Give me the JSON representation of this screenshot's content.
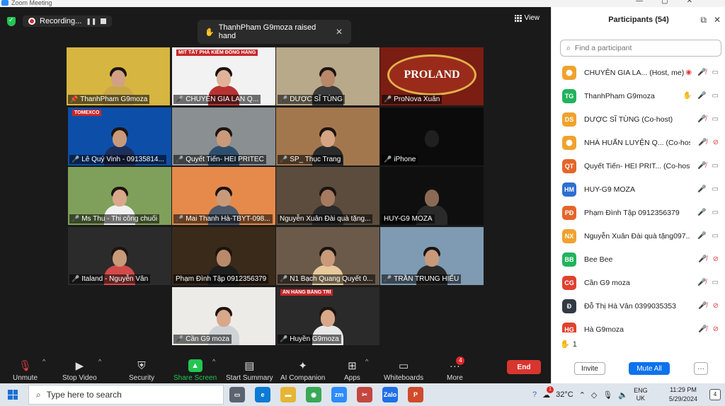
{
  "window": {
    "title": "Zoom Meeting"
  },
  "top": {
    "recording_label": "Recording...",
    "notification_text": "ThanhPham G9moza raised hand",
    "view_label": "View"
  },
  "tiles": [
    {
      "name": "ThanhPham G9moza",
      "muted": false,
      "hand": true,
      "bg": "#d6b640",
      "body": "#c9a84a",
      "hair": "#1c1410",
      "skin": "#d3a085",
      "banner": ""
    },
    {
      "name": "CHUYÊN GIA LAN Q...",
      "muted": true,
      "hand": false,
      "bg": "#f2f2f2",
      "body": "#b83232",
      "hair": "#1c1410",
      "skin": "#e0b399",
      "banner": "MIT TẮT PHÁ KIỂM ĐỒNG HÀNG"
    },
    {
      "name": "DƯỢC SĨ TÙNG",
      "muted": true,
      "hand": false,
      "bg": "#b9a98b",
      "body": "#3b3b3b",
      "hair": "#1c1410",
      "skin": "#b9876a",
      "banner": ""
    },
    {
      "name": "ProNova Xuân",
      "muted": true,
      "hand": false,
      "bg": "#7b1d12",
      "body": "#7b1d12",
      "hair": "#7b1d12",
      "skin": "#7b1d12",
      "banner": "",
      "logo": "PROLAND"
    },
    {
      "name": "Lê Quý Vinh - 09135814...",
      "muted": true,
      "hand": false,
      "bg": "#0d4fa8",
      "body": "#1d2f5c",
      "hair": "#1c1410",
      "skin": "#c99a7a",
      "banner": "TOMEXCO"
    },
    {
      "name": "Quyết Tiến- HEI PRITEC",
      "muted": true,
      "hand": false,
      "bg": "#8a8f92",
      "body": "#2e4e6e",
      "hair": "#1c1410",
      "skin": "#c99a7a",
      "banner": ""
    },
    {
      "name": "SP_ Thục Trang",
      "muted": true,
      "hand": false,
      "bg": "#a3774e",
      "body": "#2a2a2a",
      "hair": "#1c1410",
      "skin": "#d5a483",
      "banner": ""
    },
    {
      "name": "iPhone",
      "muted": true,
      "hand": false,
      "bg": "#0b0b0b",
      "body": "#0b0b0b",
      "hair": "#0b0b0b",
      "skin": "#202020",
      "banner": ""
    },
    {
      "name": "Ms Thu - Thi công chuối",
      "muted": true,
      "hand": false,
      "bg": "#7fa05a",
      "body": "#f1f1f1",
      "hair": "#1c1410",
      "skin": "#d9a88a",
      "banner": ""
    },
    {
      "name": "Mai Thanh Hà-TBYT-098...",
      "muted": true,
      "hand": false,
      "bg": "#e58a4b",
      "body": "#4d5a6b",
      "hair": "#1c1410",
      "skin": "#c99a7a",
      "banner": ""
    },
    {
      "name": "Nguyễn Xuân Đài quà tặng...",
      "muted": false,
      "hand": false,
      "bg": "#5b4c3d",
      "body": "#2a2a2a",
      "hair": "#1c1410",
      "skin": "#a57a5e",
      "banner": ""
    },
    {
      "name": "HUY-G9 MOZA",
      "muted": false,
      "hand": false,
      "bg": "#0f0f0f",
      "body": "#2a2a2a",
      "hair": "#111",
      "skin": "#8b6a55",
      "banner": ""
    },
    {
      "name": "Italand - Nguyễn Vân",
      "muted": true,
      "hand": false,
      "bg": "#2b2b2b",
      "body": "#d24a4a",
      "hair": "#1c1410",
      "skin": "#c99a7a",
      "banner": ""
    },
    {
      "name": "Phạm Đình Tập 0912356379",
      "muted": false,
      "hand": false,
      "bg": "#3a2a1a",
      "body": "#1e1e1e",
      "hair": "#1c1410",
      "skin": "#b98a6a",
      "banner": ""
    },
    {
      "name": "N1 Bạch Quang Quyết 0...",
      "muted": true,
      "hand": false,
      "bg": "#6b5a4a",
      "body": "#e7c99a",
      "hair": "#1c1410",
      "skin": "#c99a7a",
      "banner": ""
    },
    {
      "name": "TRẦN TRUNG HIẾU",
      "muted": true,
      "hand": false,
      "bg": "#7e9bb3",
      "body": "#2a2a2a",
      "hair": "#1c1410",
      "skin": "#c99a7a",
      "banner": ""
    },
    {
      "name": "Cần G9 moza",
      "muted": true,
      "hand": false,
      "bg": "#ecebe8",
      "body": "#cfd3d6",
      "hair": "#1c1410",
      "skin": "#d9a88a",
      "banner": ""
    },
    {
      "name": "Huyền G9moza",
      "muted": true,
      "hand": false,
      "bg": "#2a2a2a",
      "body": "#e8e8e8",
      "hair": "#1c1410",
      "skin": "#d9a88a",
      "banner": "ÁN HÀNG BẰNG TRÍ"
    }
  ],
  "toolbar": {
    "unmute": "Unmute",
    "stop_video": "Stop Video",
    "security": "Security",
    "share_screen": "Share Screen",
    "start_summary": "Start Summary",
    "ai_companion": "AI Companion",
    "apps": "Apps",
    "whiteboards": "Whiteboards",
    "more": "More",
    "more_badge": "4",
    "end": "End"
  },
  "panel": {
    "title": "Participants (54)",
    "search_placeholder": "Find a participant",
    "hand_count": "1",
    "invite": "Invite",
    "mute_all": "Mute All",
    "more": "···",
    "participants": [
      {
        "initials": "",
        "color": "#f0a22e",
        "name": "CHUYÊN GIA LA... (Host, me)",
        "hand": false,
        "rec": true,
        "mic": "off",
        "cam": "on",
        "logo": true
      },
      {
        "initials": "TG",
        "color": "#21b35c",
        "name": "ThanhPham G9moza",
        "hand": true,
        "rec": false,
        "mic": "on",
        "cam": "on",
        "logo": false
      },
      {
        "initials": "DS",
        "color": "#f0a22e",
        "name": "DƯỢC SĨ TÙNG (Co-host)",
        "hand": false,
        "rec": false,
        "mic": "off",
        "cam": "on",
        "logo": false
      },
      {
        "initials": "",
        "color": "#f0a22e",
        "name": "NHÀ HUẤN LUYỆN Q... (Co-host)",
        "hand": false,
        "rec": false,
        "mic": "off",
        "cam": "off",
        "logo": true
      },
      {
        "initials": "QT",
        "color": "#e5652a",
        "name": "Quyết Tiến- HEI PRIT... (Co-host)",
        "hand": false,
        "rec": false,
        "mic": "off",
        "cam": "on",
        "logo": false
      },
      {
        "initials": "HM",
        "color": "#2d6fd0",
        "name": "HUY-G9 MOZA",
        "hand": false,
        "rec": false,
        "mic": "on",
        "cam": "on",
        "logo": false
      },
      {
        "initials": "PĐ",
        "color": "#e5652a",
        "name": "Phạm Đình Tập 0912356379",
        "hand": false,
        "rec": false,
        "mic": "on",
        "cam": "on",
        "logo": false
      },
      {
        "initials": "NX",
        "color": "#f0a22e",
        "name": "Nguyễn Xuân Đài quà tặng097...",
        "hand": false,
        "rec": false,
        "mic": "on",
        "cam": "on",
        "logo": false
      },
      {
        "initials": "BB",
        "color": "#21b35c",
        "name": "Bee Bee",
        "hand": false,
        "rec": false,
        "mic": "off",
        "cam": "off",
        "logo": false
      },
      {
        "initials": "CG",
        "color": "#e0412f",
        "name": "Cần G9 moza",
        "hand": false,
        "rec": false,
        "mic": "off",
        "cam": "on",
        "logo": false
      },
      {
        "initials": "Đ",
        "color": "#333a45",
        "name": "Đỗ Thị Hà Vân 0399035353",
        "hand": false,
        "rec": false,
        "mic": "off",
        "cam": "off",
        "logo": false
      },
      {
        "initials": "HG",
        "color": "#e0412f",
        "name": "Hà G9moza",
        "hand": false,
        "rec": false,
        "mic": "off",
        "cam": "off",
        "logo": false
      }
    ]
  },
  "taskbar": {
    "search_placeholder": "Type here to search",
    "temperature": "32°C",
    "lang_top": "ENG",
    "lang_bottom": "UK",
    "time": "11:29 PM",
    "date": "5/29/2024",
    "weather_badge": "1",
    "notif_count": "4",
    "apps": [
      {
        "name": "task-view",
        "color": "#5a6470",
        "glyph": "▭"
      },
      {
        "name": "edge",
        "color": "#0b7bd3",
        "glyph": "e"
      },
      {
        "name": "file-explorer",
        "color": "#e7b535",
        "glyph": "▬"
      },
      {
        "name": "chrome",
        "color": "#3aa757",
        "glyph": "◉"
      },
      {
        "name": "zoom",
        "color": "#2d8cff",
        "glyph": "zm"
      },
      {
        "name": "snipping-tool",
        "color": "#c4473f",
        "glyph": "✂"
      },
      {
        "name": "zalo",
        "color": "#1f6fe6",
        "glyph": "Zalo"
      },
      {
        "name": "powerpoint",
        "color": "#d04a2b",
        "glyph": "P"
      }
    ]
  }
}
